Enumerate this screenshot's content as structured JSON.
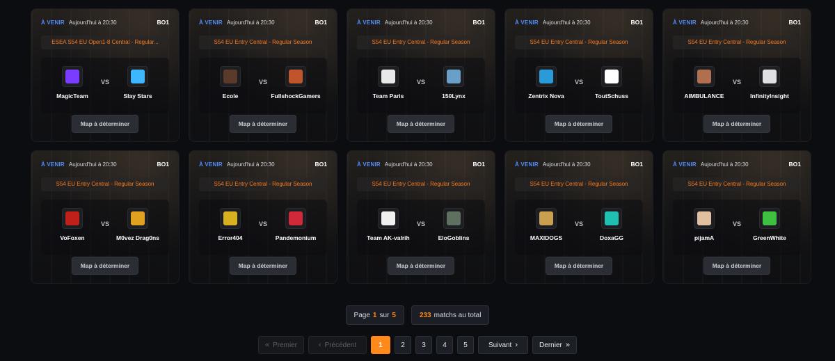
{
  "matches": [
    {
      "status": "À VENIR",
      "time": "Aujourd'hui à 20:30",
      "format": "BO1",
      "league": "ESEA S54 EU Open1-8 Central - Regular...",
      "team1": "MagicTeam",
      "team2": "Slay Stars",
      "vs": "VS",
      "map": "Map à déterminer",
      "logo1": "#7a3cff",
      "logo2": "#3fb7ff"
    },
    {
      "status": "À VENIR",
      "time": "Aujourd'hui à 20:30",
      "format": "BO1",
      "league": "S54 EU Entry Central - Regular Season",
      "team1": "Ecole",
      "team2": "FullshockGamers",
      "vs": "VS",
      "map": "Map à déterminer",
      "logo1": "#5a3a2a",
      "logo2": "#c0552b"
    },
    {
      "status": "À VENIR",
      "time": "Aujourd'hui à 20:30",
      "format": "BO1",
      "league": "S54 EU Entry Central - Regular Season",
      "team1": "Team Paris",
      "team2": "150Lynx",
      "vs": "VS",
      "map": "Map à déterminer",
      "logo1": "#e8e8e8",
      "logo2": "#6aa0c8"
    },
    {
      "status": "À VENIR",
      "time": "Aujourd'hui à 20:30",
      "format": "BO1",
      "league": "S54 EU Entry Central - Regular Season",
      "team1": "Zentrix Nova",
      "team2": "ToutSchuss",
      "vs": "VS",
      "map": "Map à déterminer",
      "logo1": "#2a9ad8",
      "logo2": "#ffffff"
    },
    {
      "status": "À VENIR",
      "time": "Aujourd'hui à 20:30",
      "format": "BO1",
      "league": "S54 EU Entry Central - Regular Season",
      "team1": "AIMBULANCE",
      "team2": "InfinityInsight",
      "vs": "VS",
      "map": "Map à déterminer",
      "logo1": "#b07050",
      "logo2": "#e0e0e0"
    },
    {
      "status": "À VENIR",
      "time": "Aujourd'hui à 20:30",
      "format": "BO1",
      "league": "S54 EU Entry Central - Regular Season",
      "team1": "VoFoxen",
      "team2": "M0vez Drag0ns",
      "vs": "VS",
      "map": "Map à déterminer",
      "logo1": "#c0201a",
      "logo2": "#e0a020"
    },
    {
      "status": "À VENIR",
      "time": "Aujourd'hui à 20:30",
      "format": "BO1",
      "league": "S54 EU Entry Central - Regular Season",
      "team1": "Error404",
      "team2": "Pandemonium",
      "vs": "VS",
      "map": "Map à déterminer",
      "logo1": "#d8b020",
      "logo2": "#d02a3a"
    },
    {
      "status": "À VENIR",
      "time": "Aujourd'hui à 20:30",
      "format": "BO1",
      "league": "S54 EU Entry Central - Regular Season",
      "team1": "Team AK-valrih",
      "team2": "EloGoblins",
      "vs": "VS",
      "map": "Map à déterminer",
      "logo1": "#f0f0f0",
      "logo2": "#607060"
    },
    {
      "status": "À VENIR",
      "time": "Aujourd'hui à 20:30",
      "format": "BO1",
      "league": "S54 EU Entry Central - Regular Season",
      "team1": "MAXIDOGS",
      "team2": "DoxaGG",
      "vs": "VS",
      "map": "Map à déterminer",
      "logo1": "#c8a050",
      "logo2": "#20c0b0"
    },
    {
      "status": "À VENIR",
      "time": "Aujourd'hui à 20:30",
      "format": "BO1",
      "league": "S54 EU Entry Central - Regular Season",
      "team1": "pijamA",
      "team2": "GreenWhite",
      "vs": "VS",
      "map": "Map à déterminer",
      "logo1": "#e0c0a0",
      "logo2": "#40c040"
    }
  ],
  "pagination": {
    "page_prefix": "Page",
    "page_current": "1",
    "page_of": "sur",
    "page_total": "5",
    "match_count": "233",
    "match_count_suffix": "matchs au total",
    "first": "Premier",
    "prev": "Précédent",
    "pages": [
      "1",
      "2",
      "3",
      "4",
      "5"
    ],
    "next": "Suivant",
    "last": "Dernier"
  }
}
